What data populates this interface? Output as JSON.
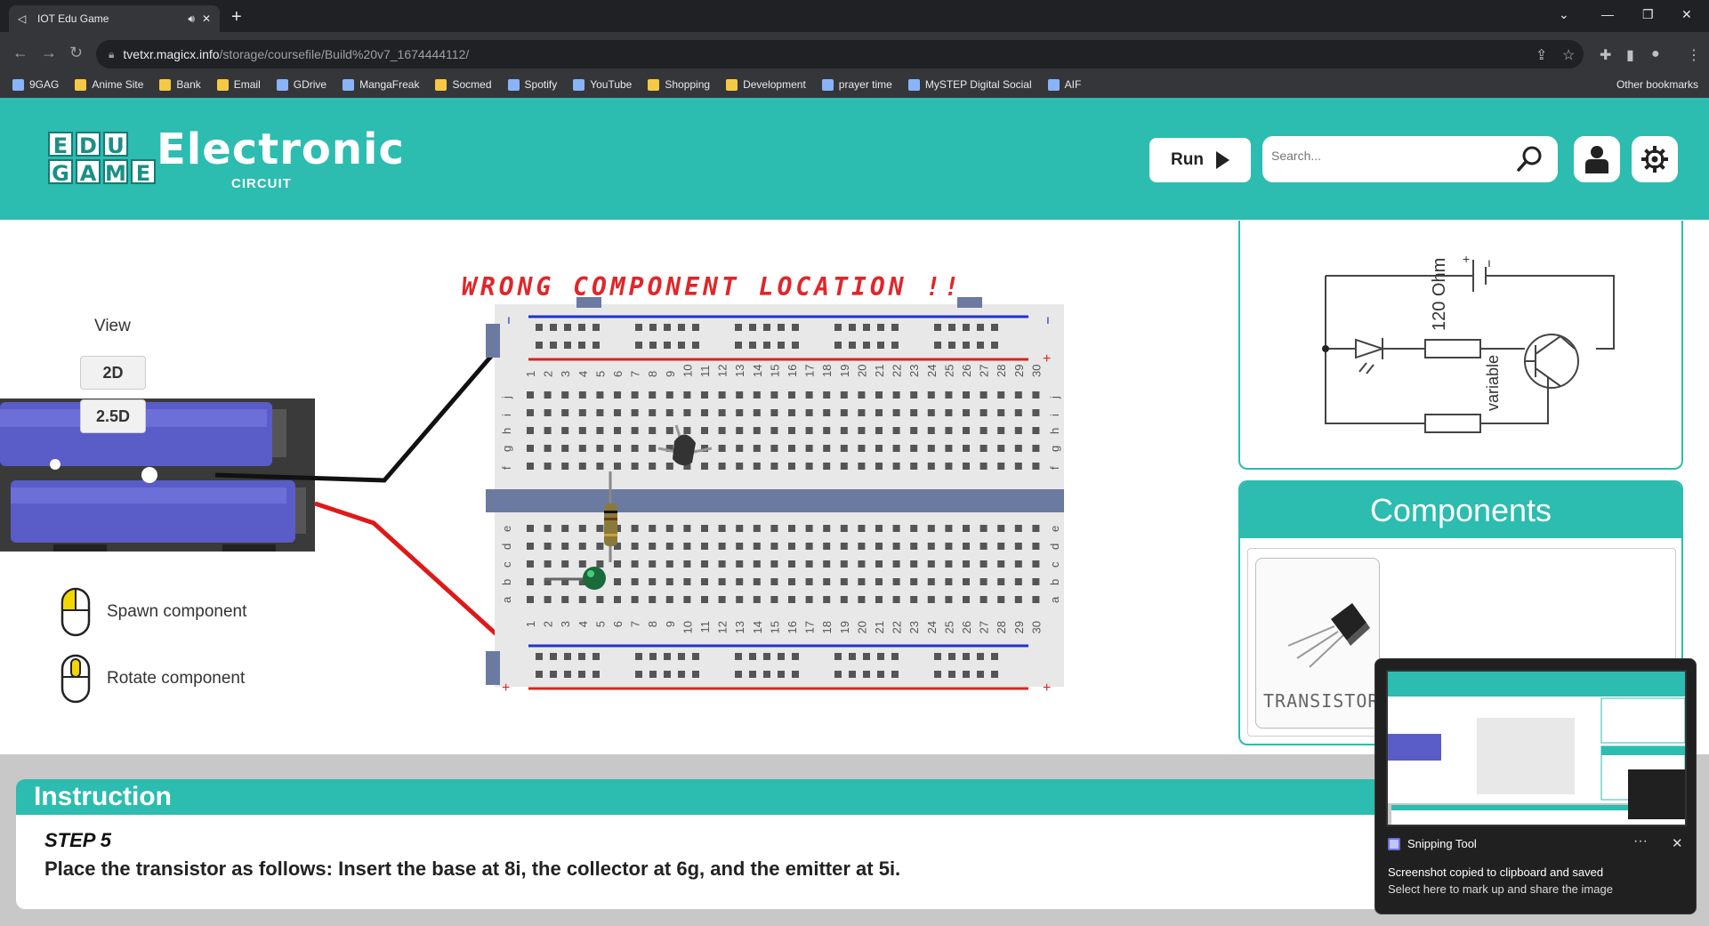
{
  "browser": {
    "tab_title": "IOT Edu Game",
    "url_host": "tvetxr.magicx.info",
    "url_path": "/storage/coursefile/Build%20v7_1674444112/",
    "bookmarks": [
      "9GAG",
      "Anime Site",
      "Bank",
      "Email",
      "GDrive",
      "MangaFreak",
      "Socmed",
      "Spotify",
      "YouTube",
      "Shopping",
      "Development",
      "prayer time",
      "MySTEP Digital Social",
      "AIF"
    ],
    "other_bookmarks": "Other bookmarks"
  },
  "header": {
    "logo_letters": [
      "E",
      "D",
      "U",
      "",
      "G",
      "A",
      "M",
      "E"
    ],
    "logo_title": "Electronic",
    "logo_subtitle": "CIRCUIT",
    "run_label": "Run",
    "search_placeholder": "Search...",
    "colors": {
      "primary": "#2cbcb0",
      "error": "#e0262a"
    }
  },
  "workspace": {
    "view_label": "View",
    "view_2d": "2D",
    "view_25d": "2.5D",
    "hint_spawn": "Spawn component",
    "hint_rotate": "Rotate component",
    "error_message": "WRONG COMPONENT LOCATION !!",
    "breadboard_columns": [
      "1",
      "2",
      "3",
      "4",
      "5",
      "6",
      "7",
      "8",
      "9",
      "10",
      "11",
      "12",
      "13",
      "14",
      "15",
      "16",
      "17",
      "18",
      "19",
      "20",
      "21",
      "22",
      "23",
      "24",
      "25",
      "26",
      "27",
      "28",
      "29",
      "30"
    ],
    "top_rows": [
      "j",
      "i",
      "h",
      "g",
      "f"
    ],
    "bottom_rows": [
      "e",
      "d",
      "c",
      "b",
      "a"
    ]
  },
  "schematic": {
    "resistor_label": "120 Ohm",
    "variable_label": "variable"
  },
  "components": {
    "title": "Components",
    "items": [
      {
        "label": "TRANSISTOR"
      }
    ]
  },
  "instruction": {
    "title": "Instruction",
    "step": "STEP 5",
    "text": "Place the transistor as follows: Insert the base at 8i, the collector at 6g, and the emitter at 5i."
  },
  "toast": {
    "app": "Snipping Tool",
    "message": "Screenshot copied to clipboard and saved",
    "sub": "Select here to mark up and share the image"
  }
}
